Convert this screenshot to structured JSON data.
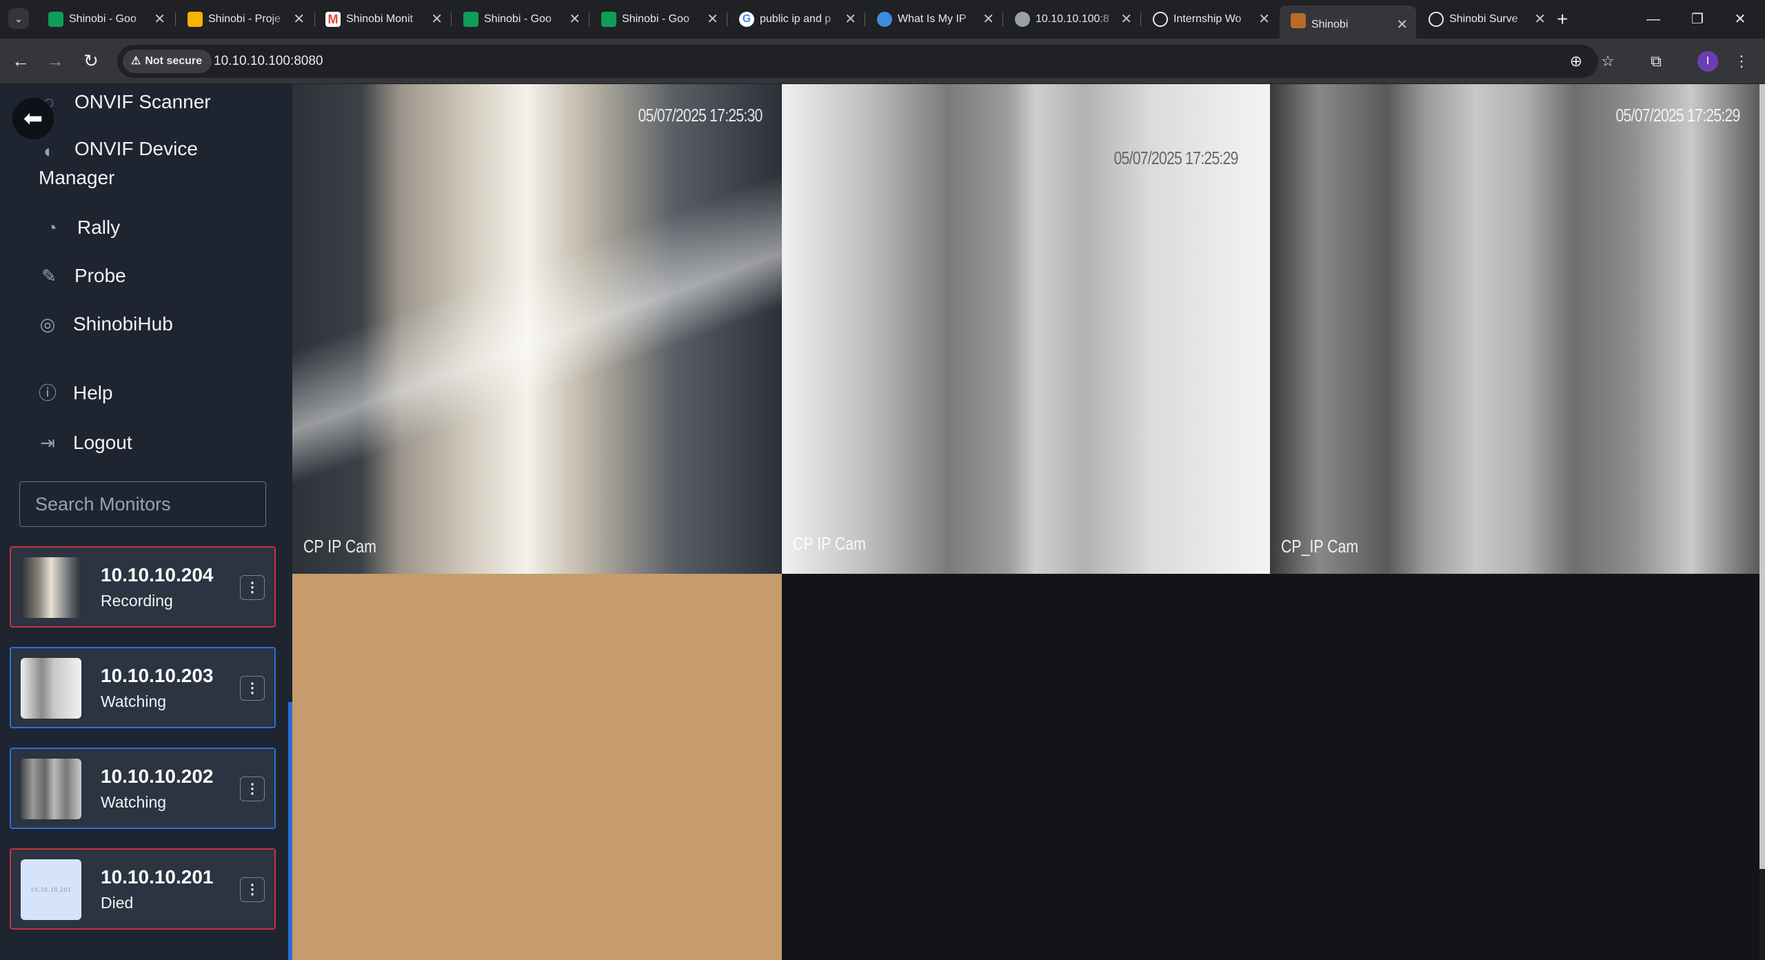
{
  "browser": {
    "tabs": [
      {
        "title": "Shinobi - Goo",
        "favicon": "sheets-icon",
        "color": "#0f9d58"
      },
      {
        "title": "Shinobi - Proje",
        "favicon": "slides-icon",
        "color": "#f4b400"
      },
      {
        "title": "Shinobi Monit",
        "favicon": "gmail-icon",
        "color": "#ea4335"
      },
      {
        "title": "Shinobi - Goo",
        "favicon": "sheets-icon",
        "color": "#0f9d58"
      },
      {
        "title": "Shinobi - Goo",
        "favicon": "sheets-icon",
        "color": "#0f9d58"
      },
      {
        "title": "public ip and p",
        "favicon": "google-icon",
        "color": "#4285f4"
      },
      {
        "title": "What Is My IP",
        "favicon": "globe-icon",
        "color": "#3c8dde"
      },
      {
        "title": "10.10.10.100:8",
        "favicon": "globe-icon",
        "color": "#9aa0a6"
      },
      {
        "title": "Internship Wo",
        "favicon": "chatgpt-icon",
        "color": "#e8eaed"
      },
      {
        "title": "Shinobi",
        "favicon": "shinobi-icon",
        "color": "#b86b2a",
        "active": true
      },
      {
        "title": "Shinobi Surve",
        "favicon": "chatgpt-icon",
        "color": "#e8eaed"
      }
    ],
    "security_label": "Not secure",
    "url": "10.10.10.100:8080",
    "profile_initial": "I"
  },
  "sidebar": {
    "items": [
      {
        "label": "ONVIF Scanner",
        "icon": "onvif-icon"
      },
      {
        "label": "ONVIF Device",
        "label2": "Manager",
        "icon": "circle-icon"
      },
      {
        "label": "Rally",
        "icon": "rally-icon"
      },
      {
        "label": "Probe",
        "icon": "eyedropper-icon"
      },
      {
        "label": "ShinobiHub",
        "icon": "hub-icon"
      },
      {
        "label": "Help",
        "icon": "info-icon"
      },
      {
        "label": "Logout",
        "icon": "logout-icon"
      }
    ],
    "search_placeholder": "Search Monitors",
    "monitors": [
      {
        "name": "10.10.10.204",
        "status": "Recording"
      },
      {
        "name": "10.10.10.203",
        "status": "Watching"
      },
      {
        "name": "10.10.10.202",
        "status": "Watching"
      },
      {
        "name": "10.10.10.201",
        "status": "Died",
        "thumb_text": "10.10.10.201"
      }
    ]
  },
  "cameras": [
    {
      "timestamp": "05/07/2025 17:25:30",
      "label": "CP IP Cam"
    },
    {
      "timestamp": "05/07/2025 17:25:29",
      "label": "CP IP Cam"
    },
    {
      "timestamp": "05/07/2025 17:25:29",
      "label": "CP_IP Cam"
    }
  ]
}
